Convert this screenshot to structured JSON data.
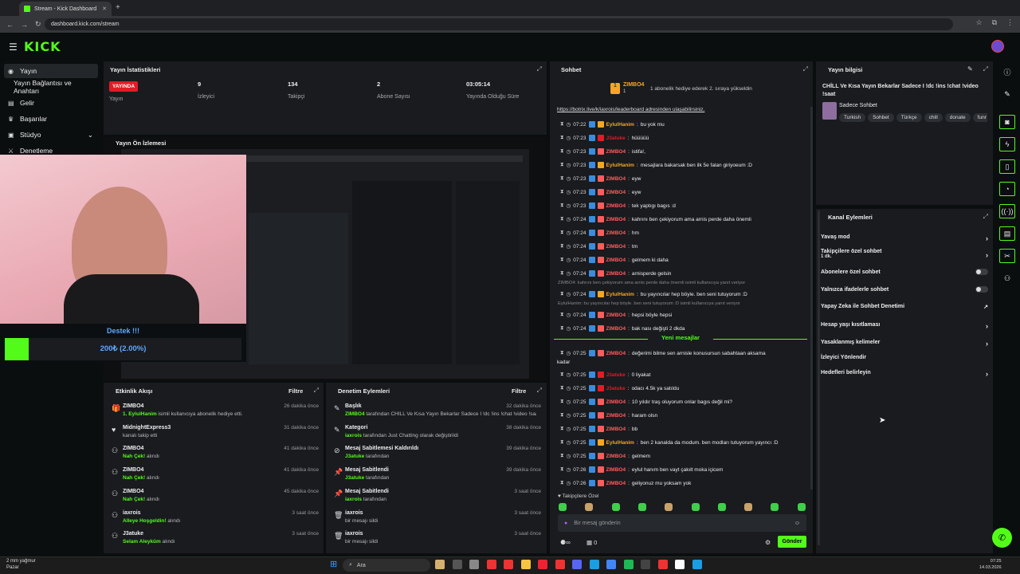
{
  "browser": {
    "tab_title": "Stream - Kick Dashboard",
    "url": "dashboard.kick.com/stream"
  },
  "brand": {
    "logo": "KICK",
    "accent": "#53fc18",
    "live_color": "#e21b26"
  },
  "sidebar": {
    "items": [
      {
        "label": "Yayın",
        "icon": "broadcast-icon"
      },
      {
        "label": "Yayın Bağlantısı ve Anahtarı",
        "icon": ""
      },
      {
        "label": "Gelir",
        "icon": "wallet-icon"
      },
      {
        "label": "Başarılar",
        "icon": "trophy-icon"
      },
      {
        "label": "Stüdyo",
        "icon": "studio-icon"
      },
      {
        "label": "Denetleme",
        "icon": "sword-icon"
      }
    ]
  },
  "stats": {
    "title": "Yayın İstatistikleri",
    "live_badge": "YAYINDA",
    "live_label": "Yayın",
    "items": [
      {
        "value": "9",
        "label": "İzleyici"
      },
      {
        "value": "134",
        "label": "Takipçi"
      },
      {
        "value": "2",
        "label": "Abone Sayısı"
      },
      {
        "value": "03:05:14",
        "label": "Yayında Olduğu Süre"
      }
    ]
  },
  "preview": {
    "title": "Yayın Ön İzlemesi"
  },
  "overlay": {
    "destek": "Destek !!!",
    "amount": "200₺ (2.00%)",
    "progress": 0.02
  },
  "events": {
    "title": "Etkinlik Akışı",
    "filter": "Filtre",
    "items": [
      {
        "icon": "gift-icon",
        "name": "ZIMBO4",
        "desc_hl": "1. EylulHanim",
        "desc": " isimli kullanıcıya abonelik hediye etti.",
        "time": "26 dakika önce"
      },
      {
        "icon": "heart-icon",
        "name": "MidnightExpress3",
        "desc_hl": "",
        "desc": "kanalı takip etti",
        "time": "31 dakika önce"
      },
      {
        "icon": "points-icon",
        "name": "ZIMBO4",
        "desc_hl": "Nah Çek!",
        "desc": " alındı",
        "time": "41 dakika önce"
      },
      {
        "icon": "points-icon",
        "name": "ZIMBO4",
        "desc_hl": "Nah Çek!",
        "desc": " alındı",
        "time": "41 dakika önce"
      },
      {
        "icon": "points-icon",
        "name": "ZIMBO4",
        "desc_hl": "Nah Çek!",
        "desc": " alındı",
        "time": "45 dakika önce"
      },
      {
        "icon": "points-icon",
        "name": "iaxrois",
        "desc_hl": "Alleye Hoşgeldin!",
        "desc": " alındı",
        "time": "3 saat önce"
      },
      {
        "icon": "points-icon",
        "name": "J3atuke",
        "desc_hl": "Selam Aleyküm",
        "desc": " alındı",
        "time": "3 saat önce"
      }
    ]
  },
  "moderation": {
    "title": "Denetim Eylemleri",
    "filter": "Filtre",
    "items": [
      {
        "icon": "edit-icon",
        "name": "Başlık",
        "desc_hl": "ZIMBO4",
        "desc": " tarafından CHİLL Ve Kısa Yayın Bekarlar Sadece I !dc !ins !chat !video !saat olarak değiştirildi",
        "time": "32 dakika önce"
      },
      {
        "icon": "edit-icon",
        "name": "Kategori",
        "desc_hl": "iaxrois",
        "desc": " tarafından Just Chatting olarak değiştirildi",
        "time": "38 dakika önce"
      },
      {
        "icon": "unpin-icon",
        "name": "Mesaj Sabitlemesi Kaldırıldı",
        "desc_hl": "J3atuke",
        "desc": " tarafından",
        "time": "39 dakika önce"
      },
      {
        "icon": "pin-icon",
        "name": "Mesaj Sabitlendi",
        "desc_hl": "J3atuke",
        "desc": " tarafından",
        "time": "39 dakika önce"
      },
      {
        "icon": "pin-icon",
        "name": "Mesaj Sabitlendi",
        "desc_hl": "iaxrois",
        "desc": " tarafından",
        "time": "3 saat önce"
      },
      {
        "icon": "trash-icon",
        "name": "iaxrois",
        "desc_hl": "",
        "desc": "bir mesajı sildi",
        "time": "3 saat önce"
      },
      {
        "icon": "trash-icon",
        "name": "iaxrois",
        "desc_hl": "",
        "desc": "bir mesajı sildi",
        "time": "3 saat önce"
      }
    ]
  },
  "chat": {
    "title": "Sohbet",
    "pinned_user": "ZIMBO4",
    "pinned_sub": "1",
    "pinned_text": "1 abonelik hediye ederek 2. sıraya yükseldin",
    "top_link": "https://botrix.live/k/iaxrois/leaderboard adresinden ulaşabilirsiniz.",
    "new_messages": "Yeni mesajlar",
    "followers_only": "Takipçilere Özel",
    "placeholder": "Bir mesaj gönderin",
    "send": "Gönder",
    "points": "0",
    "lines": [
      {
        "time": "07:22",
        "user": "EylulHanim",
        "color": "#f5a623",
        "text": "bu yok mu"
      },
      {
        "time": "07:23",
        "user": "J3atuke",
        "color": "#e21b26",
        "text": "hüüüüü"
      },
      {
        "time": "07:23",
        "user": "ZIMBO4",
        "color": "#ff5c5c",
        "text": "istifa!,"
      },
      {
        "time": "07:23",
        "user": "EylulHanim",
        "color": "#f5a623",
        "text": "mesajlara bakarsak ben ilk 5e falan giriyoeum :D"
      },
      {
        "time": "07:23",
        "user": "ZIMBO4",
        "color": "#ff5c5c",
        "text": "eyw"
      },
      {
        "time": "07:23",
        "user": "ZIMBO4",
        "color": "#ff5c5c",
        "text": "eyw"
      },
      {
        "time": "07:23",
        "user": "ZIMBO4",
        "color": "#ff5c5c",
        "text": "tek yaptıgı bagıs :d"
      },
      {
        "time": "07:24",
        "user": "ZIMBO4",
        "color": "#ff5c5c",
        "text": "kahrını ben çekiyorum ama arnis perde daha önemli"
      },
      {
        "time": "07:24",
        "user": "ZIMBO4",
        "color": "#ff5c5c",
        "text": "hm"
      },
      {
        "time": "07:24",
        "user": "ZIMBO4",
        "color": "#ff5c5c",
        "text": "tm"
      },
      {
        "time": "07:24",
        "user": "ZIMBO4",
        "color": "#ff5c5c",
        "text": "gelmem ki daha"
      },
      {
        "time": "07:24",
        "user": "ZIMBO4",
        "color": "#ff5c5c",
        "text": "arnisperde gelsin"
      },
      {
        "time": "07:24",
        "user": "EylulHanim",
        "color": "#f5a623",
        "text": "bu yayıncılar hep böyle. ben seni tutuyorum :D",
        "reply": "ZIMBO4: kahrını ben çekiyorum ama arnis perde daha önemli isimli kullanıcıya yanıt veriyor"
      },
      {
        "time": "07:24",
        "user": "ZIMBO4",
        "color": "#ff5c5c",
        "text": "hepsi böyle hepsi",
        "reply": "EylulHanim: bu yayıncılar hep böyle. ben seni tutuyorum :D isimli kullanıcıya yanıt veriyor"
      },
      {
        "time": "07:24",
        "user": "ZIMBO4",
        "color": "#ff5c5c",
        "text": "bak nası değişti 2 dkda"
      },
      {
        "time": "07:25",
        "user": "ZIMBO4",
        "color": "#ff5c5c",
        "text": "değerimi bilme sen arnisle konusursun sabahtaan aksama",
        "cont": "kadar"
      },
      {
        "time": "07:25",
        "user": "J3atuke",
        "color": "#e21b26",
        "text": "0 liyakat"
      },
      {
        "time": "07:25",
        "user": "J3atuke",
        "color": "#e21b26",
        "text": "odacı 4.5k ya satıldu"
      },
      {
        "time": "07:25",
        "user": "ZIMBO4",
        "color": "#ff5c5c",
        "text": "10 yıldır traş oluyorum onlar bagıs değil mi?"
      },
      {
        "time": "07:25",
        "user": "ZIMBO4",
        "color": "#ff5c5c",
        "text": "haram olsn"
      },
      {
        "time": "07:25",
        "user": "ZIMBO4",
        "color": "#ff5c5c",
        "text": "bb"
      },
      {
        "time": "07:25",
        "user": "EylulHanim",
        "color": "#f5a623",
        "text": "ben 2 kanalda da modum. ben modları tutuyorum yayıncı :D"
      },
      {
        "time": "07:25",
        "user": "ZIMBO4",
        "color": "#ff5c5c",
        "text": "gelmem"
      },
      {
        "time": "07:26",
        "user": "ZIMBO4",
        "color": "#ff5c5c",
        "text": "eylul hanım ben vayt çakılt moka içicem"
      },
      {
        "time": "07:26",
        "user": "ZIMBO4",
        "color": "#ff5c5c",
        "text": "geliyonuz mu yoksam yok"
      }
    ]
  },
  "stream_info": {
    "title": "Yayın bilgisi",
    "stream_title": "CHİLL Ve Kısa Yayın Bekarlar Sadece I !dc !ins !chat !video !saat",
    "category": "Sadece Sohbet",
    "tags": [
      "Turkish",
      "Sohbet",
      "Türkçe",
      "chill",
      "donate",
      "funr"
    ]
  },
  "channel_actions": {
    "title": "Kanal Eylemleri",
    "items": [
      {
        "label": "Yavaş mod",
        "sub": "",
        "kind": "chevron"
      },
      {
        "label": "Takipçilere özel sohbet",
        "sub": "1 dk.",
        "kind": "chevron"
      },
      {
        "label": "Abonelere özel sohbet",
        "sub": "",
        "kind": "toggle"
      },
      {
        "label": "Yalnızca ifadelerle sohbet",
        "sub": "",
        "kind": "toggle"
      },
      {
        "label": "Yapay Zeka ile Sohbet Denetimi",
        "sub": "",
        "kind": "external"
      },
      {
        "label": "Hesap yaşı kısıtlaması",
        "sub": "",
        "kind": "chevron"
      },
      {
        "label": "Yasaklanmış kelimeler",
        "sub": "",
        "kind": "chevron"
      },
      {
        "label": "İzleyici Yönlendir",
        "sub": "",
        "kind": "none"
      },
      {
        "label": "Hedefleri belirleyin",
        "sub": "",
        "kind": "chevron"
      }
    ]
  },
  "taskbar": {
    "weather_temp": "2 mm yağmur",
    "weather_desc": "Pazar",
    "search": "Ara",
    "time": "07:25",
    "date": "14.03.2026"
  }
}
